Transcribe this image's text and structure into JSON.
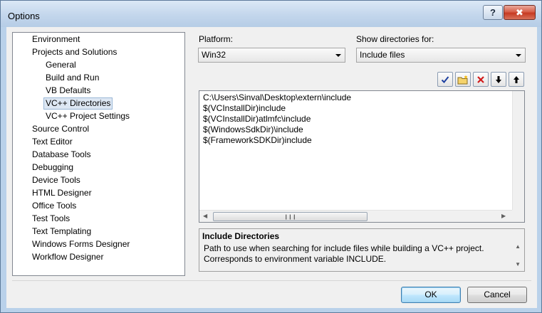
{
  "window": {
    "title": "Options",
    "help_label": "?",
    "close_label": "✖"
  },
  "tree": {
    "items": [
      {
        "label": "Environment",
        "level": 0
      },
      {
        "label": "Projects and Solutions",
        "level": 0
      },
      {
        "label": "General",
        "level": 1
      },
      {
        "label": "Build and Run",
        "level": 1
      },
      {
        "label": "VB Defaults",
        "level": 1
      },
      {
        "label": "VC++ Directories",
        "level": 1,
        "selected": true
      },
      {
        "label": "VC++ Project Settings",
        "level": 1
      },
      {
        "label": "Source Control",
        "level": 0
      },
      {
        "label": "Text Editor",
        "level": 0
      },
      {
        "label": "Database Tools",
        "level": 0
      },
      {
        "label": "Debugging",
        "level": 0
      },
      {
        "label": "Device Tools",
        "level": 0
      },
      {
        "label": "HTML Designer",
        "level": 0
      },
      {
        "label": "Office Tools",
        "level": 0
      },
      {
        "label": "Test Tools",
        "level": 0
      },
      {
        "label": "Text Templating",
        "level": 0
      },
      {
        "label": "Windows Forms Designer",
        "level": 0
      },
      {
        "label": "Workflow Designer",
        "level": 0
      }
    ]
  },
  "platform": {
    "label": "Platform:",
    "value": "Win32"
  },
  "show_dirs": {
    "label": "Show directories for:",
    "value": "Include files"
  },
  "toolbar": {
    "buttons": [
      "checkmark-icon",
      "new-folder-icon",
      "delete-icon",
      "move-down-icon",
      "move-up-icon"
    ]
  },
  "directories": [
    "C:\\Users\\Sinval\\Desktop\\extern\\include",
    "$(VCInstallDir)include",
    "$(VCInstallDir)atlmfc\\include",
    "$(WindowsSdkDir)\\include",
    "$(FrameworkSDKDir)include"
  ],
  "description": {
    "title": "Include Directories",
    "text": "Path to use when searching for include files while building a VC++ project. Corresponds to environment variable INCLUDE."
  },
  "buttons": {
    "ok": "OK",
    "cancel": "Cancel"
  },
  "colors": {
    "accent": "#3c7fb1",
    "close": "#c63a22",
    "selection": "#dde7f3"
  }
}
